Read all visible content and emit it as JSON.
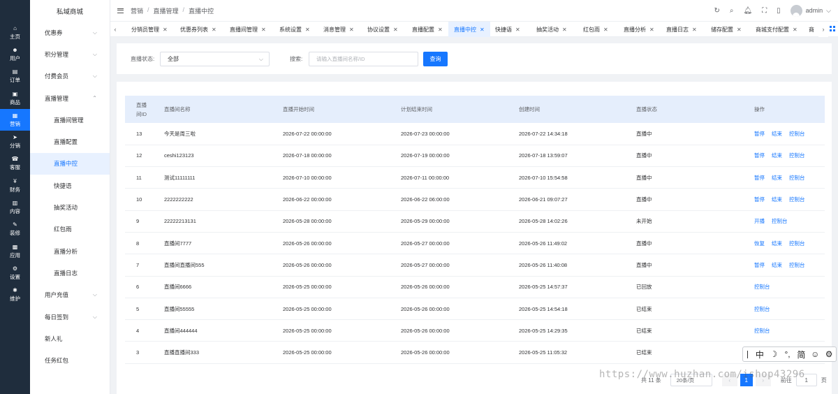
{
  "brand": "私域商城",
  "rail": [
    {
      "label": "主页",
      "icon": "home-icon"
    },
    {
      "label": "用户",
      "icon": "user-icon"
    },
    {
      "label": "订单",
      "icon": "order-icon"
    },
    {
      "label": "商品",
      "icon": "goods-icon"
    },
    {
      "label": "营销",
      "icon": "marketing-icon",
      "active": true
    },
    {
      "label": "分销",
      "icon": "send-icon"
    },
    {
      "label": "客服",
      "icon": "service-icon"
    },
    {
      "label": "财务",
      "icon": "finance-icon"
    },
    {
      "label": "内容",
      "icon": "content-icon"
    },
    {
      "label": "装修",
      "icon": "decorate-icon"
    },
    {
      "label": "应用",
      "icon": "apps-icon"
    },
    {
      "label": "设置",
      "icon": "gear-icon"
    },
    {
      "label": "维护",
      "icon": "maintain-icon"
    }
  ],
  "menu": [
    {
      "label": "优惠券",
      "chevron": "⌵"
    },
    {
      "label": "积分管理",
      "chevron": "⌵"
    },
    {
      "label": "付费会员",
      "chevron": "⌵"
    },
    {
      "label": "直播管理",
      "chevron": "⌃"
    },
    {
      "label": "直播间管理",
      "sub": true
    },
    {
      "label": "直播配置",
      "sub": true
    },
    {
      "label": "直播中控",
      "sub": true,
      "active": true
    },
    {
      "label": "快捷语",
      "sub": true
    },
    {
      "label": "抽奖活动",
      "sub": true
    },
    {
      "label": "红包雨",
      "sub": true
    },
    {
      "label": "直播分析",
      "sub": true
    },
    {
      "label": "直播日志",
      "sub": true
    },
    {
      "label": "用户充值",
      "chevron": "⌵"
    },
    {
      "label": "每日签到",
      "chevron": "⌵"
    },
    {
      "label": "新人礼"
    },
    {
      "label": "任务红包"
    }
  ],
  "breadcrumb": [
    "营销",
    "直播管理",
    "直播中控"
  ],
  "breadcrumb_sep": "/",
  "header": {
    "username": "admin",
    "user_caret": "⌵"
  },
  "tabs": [
    {
      "label": "分销员管理"
    },
    {
      "label": "优惠券列表"
    },
    {
      "label": "直播间管理"
    },
    {
      "label": "系统设置"
    },
    {
      "label": "消息管理"
    },
    {
      "label": "协议设置"
    },
    {
      "label": "直播配置"
    },
    {
      "label": "直播中控",
      "active": true
    },
    {
      "label": "快捷语"
    },
    {
      "label": "抽奖活动"
    },
    {
      "label": "红包雨"
    },
    {
      "label": "直播分析"
    },
    {
      "label": "直播日志"
    },
    {
      "label": "储存配置"
    },
    {
      "label": "商城支付配置"
    },
    {
      "label": "商"
    }
  ],
  "filter": {
    "status_label": "直播状态:",
    "status_value": "全部",
    "search_label": "搜索:",
    "search_placeholder": "请输入直播间名称/ID",
    "query_button": "查询"
  },
  "table": {
    "headers": [
      "直播间ID",
      "直播间名称",
      "直播开始时间",
      "计划结束时间",
      "创建时间",
      "直播状态",
      "操作"
    ],
    "rows": [
      {
        "id": "13",
        "name": "今天是周三啦",
        "start": "2026-07-22 00:00:00",
        "end": "2026-07-23 00:00:00",
        "created": "2026-07-22 14:34:18",
        "status": "直播中",
        "actions": [
          "暂停",
          "结束",
          "控制台"
        ]
      },
      {
        "id": "12",
        "name": "ceshi123123",
        "start": "2026-07-18 00:00:00",
        "end": "2026-07-19 00:00:00",
        "created": "2026-07-18 13:59:07",
        "status": "直播中",
        "actions": [
          "暂停",
          "结束",
          "控制台"
        ]
      },
      {
        "id": "11",
        "name": "测试11111111",
        "start": "2026-07-10 00:00:00",
        "end": "2026-07-11 00:00:00",
        "created": "2026-07-10 15:54:58",
        "status": "直播中",
        "actions": [
          "暂停",
          "结束",
          "控制台"
        ]
      },
      {
        "id": "10",
        "name": "2222222222",
        "start": "2026-06-22 00:00:00",
        "end": "2026-06-22 06:00:00",
        "created": "2026-06-21 09:07:27",
        "status": "直播中",
        "actions": [
          "暂停",
          "结束",
          "控制台"
        ]
      },
      {
        "id": "9",
        "name": "22222213131",
        "start": "2026-05-28 00:00:00",
        "end": "2026-05-29 00:00:00",
        "created": "2026-05-28 14:02:26",
        "status": "未开始",
        "actions": [
          "开播",
          "控制台"
        ]
      },
      {
        "id": "8",
        "name": "直播间7777",
        "start": "2026-05-26 00:00:00",
        "end": "2026-05-27 00:00:00",
        "created": "2026-05-26 11:49:02",
        "status": "直播中",
        "actions": [
          "恢复",
          "结束",
          "控制台"
        ]
      },
      {
        "id": "7",
        "name": "直播间直播间555",
        "start": "2026-05-26 00:00:00",
        "end": "2026-05-27 00:00:00",
        "created": "2026-05-26 11:40:08",
        "status": "直播中",
        "actions": [
          "暂停",
          "结束",
          "控制台"
        ]
      },
      {
        "id": "6",
        "name": "直播间6666",
        "start": "2026-05-25 00:00:00",
        "end": "2026-05-26 00:00:00",
        "created": "2026-05-25 14:57:37",
        "status": "已回放",
        "actions": [
          "控制台"
        ]
      },
      {
        "id": "5",
        "name": "直播间55555",
        "start": "2026-05-25 00:00:00",
        "end": "2026-05-26 00:00:00",
        "created": "2026-05-25 14:54:18",
        "status": "已结束",
        "actions": [
          "控制台"
        ]
      },
      {
        "id": "4",
        "name": "直播间444444",
        "start": "2026-05-25 00:00:00",
        "end": "2026-05-26 00:00:00",
        "created": "2026-05-25 14:29:35",
        "status": "已结束",
        "actions": [
          "控制台"
        ]
      },
      {
        "id": "3",
        "name": "直播直播间333",
        "start": "2026-05-25 00:00:00",
        "end": "2026-05-26 00:00:00",
        "created": "2026-05-25 11:05:32",
        "status": "已结束",
        "actions": []
      }
    ]
  },
  "pagination": {
    "total_text": "共 11 条",
    "page_size": "20条/页",
    "current_page": "1",
    "goto_label": "前往",
    "goto_value": "1",
    "page_suffix": "页"
  },
  "ime_toolbar": [
    "中",
    "☽",
    "°,",
    "简",
    "☺",
    "⚙"
  ],
  "watermark": "https://www.huzhan.com/ishop43296"
}
